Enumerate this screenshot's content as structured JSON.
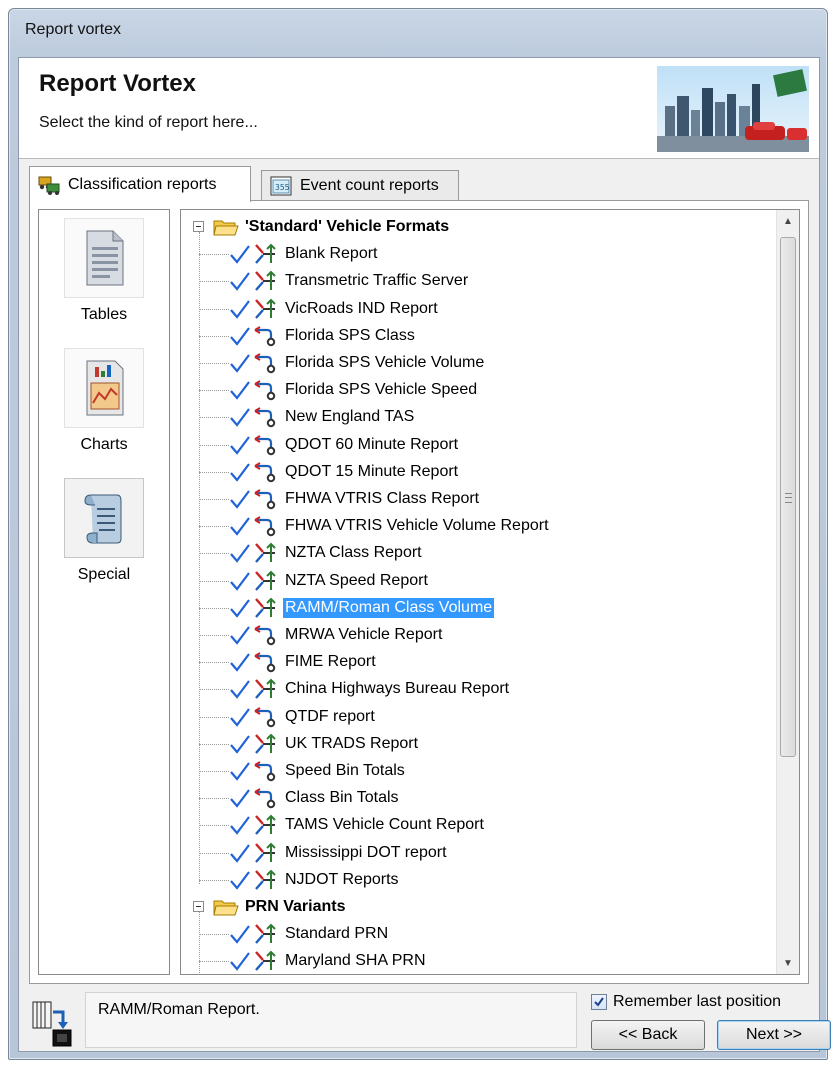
{
  "window": {
    "title": "Report vortex"
  },
  "header": {
    "title": "Report Vortex",
    "subtitle": "Select the kind of report here..."
  },
  "tabs": [
    {
      "label": "Classification reports",
      "icon": "classification-icon",
      "active": true
    },
    {
      "label": "Event count reports",
      "icon": "event-count-icon",
      "active": false
    }
  ],
  "side": [
    {
      "label": "Tables",
      "icon": "document-icon"
    },
    {
      "label": "Charts",
      "icon": "chart-icon"
    },
    {
      "label": "Special",
      "icon": "scroll-icon",
      "selected": true
    }
  ],
  "tree": {
    "groups": [
      {
        "label": "'Standard' Vehicle Formats",
        "items": [
          {
            "label": "Blank Report",
            "icon": "merge"
          },
          {
            "label": "Transmetric Traffic Server",
            "icon": "merge"
          },
          {
            "label": "VicRoads IND Report",
            "icon": "merge"
          },
          {
            "label": "Florida SPS Class",
            "icon": "route"
          },
          {
            "label": "Florida SPS Vehicle Volume",
            "icon": "route"
          },
          {
            "label": "Florida SPS Vehicle Speed",
            "icon": "route"
          },
          {
            "label": "New England TAS",
            "icon": "route"
          },
          {
            "label": "QDOT 60 Minute Report",
            "icon": "route"
          },
          {
            "label": "QDOT 15 Minute Report",
            "icon": "route"
          },
          {
            "label": "FHWA VTRIS Class Report",
            "icon": "route"
          },
          {
            "label": "FHWA VTRIS Vehicle Volume Report",
            "icon": "route"
          },
          {
            "label": "NZTA Class Report",
            "icon": "merge"
          },
          {
            "label": "NZTA Speed Report",
            "icon": "merge"
          },
          {
            "label": "RAMM/Roman Class Volume",
            "icon": "merge",
            "selected": true
          },
          {
            "label": "MRWA Vehicle Report",
            "icon": "route"
          },
          {
            "label": "FIME Report",
            "icon": "route"
          },
          {
            "label": "China Highways Bureau Report",
            "icon": "merge"
          },
          {
            "label": "QTDF report",
            "icon": "route"
          },
          {
            "label": "UK TRADS Report",
            "icon": "merge"
          },
          {
            "label": "Speed Bin Totals",
            "icon": "route"
          },
          {
            "label": "Class Bin Totals",
            "icon": "route"
          },
          {
            "label": "TAMS Vehicle Count Report",
            "icon": "merge"
          },
          {
            "label": "Mississippi DOT report",
            "icon": "merge"
          },
          {
            "label": "NJDOT Reports",
            "icon": "merge"
          }
        ]
      },
      {
        "label": "PRN Variants",
        "items": [
          {
            "label": "Standard PRN",
            "icon": "merge"
          },
          {
            "label": "Maryland SHA PRN",
            "icon": "merge"
          }
        ]
      }
    ]
  },
  "status": {
    "text": "RAMM/Roman Report."
  },
  "remember": {
    "label": "Remember last position",
    "checked": true
  },
  "buttons": {
    "back": "<< Back",
    "next": "Next >>"
  },
  "colors": {
    "selection": "#3399ff",
    "check": "#1f63d6",
    "arrow_red": "#cc2222",
    "arrow_blue": "#1e5fb8"
  }
}
